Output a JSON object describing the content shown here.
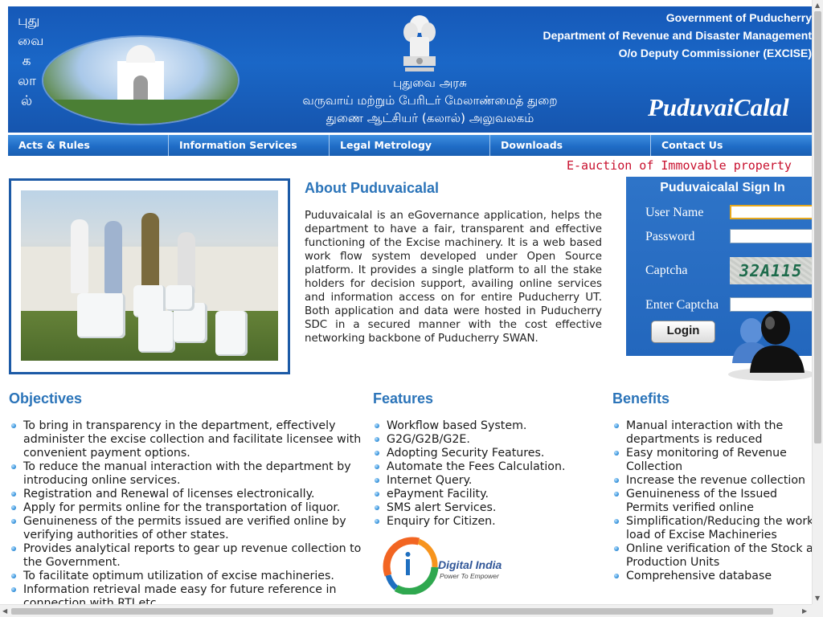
{
  "header": {
    "tamil_vertical": "புதுவைகலால்",
    "tamil_lines": [
      "புதுவை அரசு",
      "வருவாய் மற்றும் பேரிடர் மேலாண்மைத் துறை",
      "துணை ஆட்சியர் (கலால்) அலுவலகம்"
    ],
    "gov_lines": [
      "Government of Puducherry",
      "Department of Revenue and Disaster Management",
      "O/o Deputy Commissioner (EXCISE)"
    ],
    "brand_title": "PuduvaiCalal"
  },
  "nav": {
    "items": [
      "Acts & Rules",
      "Information Services",
      "Legal Metrology",
      "Downloads",
      "Contact Us"
    ]
  },
  "marquee": {
    "text": "E-auction of Immovable property"
  },
  "about": {
    "title": "About Puduvaicalal",
    "text": "Puduvaicalal is an eGovernance application, helps the department to have a fair, transparent and effective functioning of the Excise machinery. It is a web based work flow system developed under Open Source platform. It provides a single platform to all the stake holders for decision support, availing online services and information access on for entire Puducherry UT. Both application and data were hosted in Puducherry SDC in a secured manner with the cost effective networking backbone of Puducherry SWAN."
  },
  "signin": {
    "title": "Puduvaicalal Sign In",
    "user_label": "User Name",
    "password_label": "Password",
    "captcha_label": "Captcha",
    "captcha_value": "32A115",
    "enter_captcha_label": "Enter Captcha",
    "login_label": "Login"
  },
  "objectives": {
    "title": "Objectives",
    "items": [
      "To bring in transparency in the department, effectively administer the excise collection and facilitate licensee with convenient payment options.",
      "To reduce the manual interaction with the department by introducing online services.",
      "Registration and Renewal of licenses electronically.",
      "Apply for permits online for the transportation of liquor.",
      "Genuineness of the permits issued are verified online by verifying authorities of other states.",
      "Provides analytical reports to gear up revenue collection to the Government.",
      "To facilitate optimum utilization of excise machineries.",
      "Information retrieval made easy for future reference in connection with RTI etc."
    ]
  },
  "features": {
    "title": "Features",
    "items": [
      "Workflow based System.",
      "G2G/G2B/G2E.",
      "Adopting Security Features.",
      "Automate the Fees Calculation.",
      "Internet Query.",
      "ePayment Facility.",
      "SMS alert Services.",
      "Enquiry for Citizen."
    ]
  },
  "benefits": {
    "title": "Benefits",
    "items": [
      "Manual interaction with the departments is reduced",
      "Easy monitoring of Revenue Collection",
      "Increase the revenue collection",
      "Genuineness of the Issued Permits verified online",
      "Simplification/Reducing the work load of Excise Machineries",
      "Online verification of the Stock at Production Units",
      "Comprehensive database"
    ]
  },
  "digital_india": {
    "title": "Digital India",
    "tagline": "Power To Empower"
  },
  "colors": {
    "banner_blue": "#1a67c7",
    "heading_blue": "#2b74b9",
    "marquee_red": "#c8102e",
    "signin_blue": "#2e74c8"
  },
  "icons": {
    "bullet": "blue-bullet-icon",
    "user": "user-silhouette-icon",
    "emblem": "national-emblem-icon"
  }
}
